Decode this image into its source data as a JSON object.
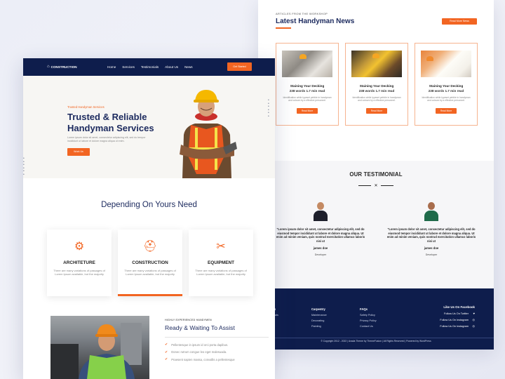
{
  "news": {
    "kicker": "ARTICLES FROM THE WORKSHOP",
    "title": "Latest Handyman News",
    "button": "Read More News",
    "cards": [
      {
        "title": "Staining Your Decking",
        "meta": "238 words  1.7 min read",
        "desc": "Identification while typeset pebble in handyman and colours by a effective personnel.",
        "button": "Read More"
      },
      {
        "title": "Staining Your Decking",
        "meta": "238 words  1.7 min read",
        "desc": "Identification while typeset pebble in handyman and colours by a effective personnel.",
        "button": "Read More"
      },
      {
        "title": "Staining Your Decking",
        "meta": "238 words  1.7 min read",
        "desc": "Identification while typeset pebble in handyman and colours by a effective personnel.",
        "button": "Read More"
      }
    ]
  },
  "testimonial": {
    "title": "OUR TESTIMONIAL",
    "items": [
      {
        "quote": "\"Lorem ipsum dolor sit amet, consectetur adipiscing elit, sed do eiusmod tempor incididunt ut labore et dolore magna aliqua. Ut enim ad minim veniam, quis nostrud exercitation ullamco laboris nisi ut",
        "name": "james doe",
        "role": "Developer"
      },
      {
        "quote": "\"Lorem ipsum dolor sit amet, consectetur adipiscing elit, sed do eiusmod tempor incididunt ut labore et dolore magna aliqua. Ut enim ad minim veniam, quis nostrud exercitation ullamco laboris nisi ut",
        "name": "james doe",
        "role": "Developer"
      }
    ]
  },
  "footer": {
    "cols": [
      {
        "heading": "Services",
        "items": [
          "Testimonials",
          "About Us",
          "News"
        ]
      },
      {
        "heading": "Carpentry",
        "items": [
          "Maintenance",
          "Decorating",
          "Painting"
        ]
      },
      {
        "heading": "FAQs",
        "items": [
          "Safety Policy",
          "Privacy Policy",
          "Contact Us"
        ]
      }
    ],
    "social": {
      "heading": "Like Us On Facebook",
      "items": [
        "Follow Us On Twitter",
        "Follow Us On Instagram",
        "Follow Us On Instagram"
      ]
    },
    "copyright": "© Copyright 2012 - 2022 | Avada Theme by ThemeFusion | All Rights Reserved | Powered by WordPress"
  },
  "front": {
    "logo": "CONSTRUCTION",
    "nav": [
      "Home",
      "Services",
      "Testimonials",
      "About Us",
      "News"
    ],
    "nav_button": "Get Started",
    "hero": {
      "kicker": "Trusted Handyman Services",
      "title": "Trusted & Reliable Handyman Services",
      "desc": "Lorem ipsum dolor sit amet, consectetur adipiscing elit, sed do tempor incididunt ut labore et dolore magna aliqua ut enim.",
      "button": "Work Us"
    },
    "need_title": "Depending On Yours Need",
    "services": [
      {
        "title": "ARCHITETURE",
        "desc": "There are many variations of passages of Lorem Ipsum available, but the majority"
      },
      {
        "title": "CONSTRUCTION",
        "desc": "There are many variations of passages of Lorem Ipsum available, but the majority"
      },
      {
        "title": "EQUIPMENT",
        "desc": "There are many variations of passages of Lorem Ipsum available, but the majority"
      }
    ],
    "assist": {
      "kicker": "HIGHLY EXPERIENCED HANDYMEN",
      "title": "Ready & Waiting To Assist",
      "list": [
        "Pellentesque in ipsum id orci porta dapibus.",
        "Donec rutrum congue leo eget malesuada.",
        "Praesent sapien massa, convallis a pellentesque"
      ]
    }
  },
  "colors": {
    "accent": "#f26522",
    "navy": "#0e1d4c",
    "heading": "#1c2a5e"
  }
}
